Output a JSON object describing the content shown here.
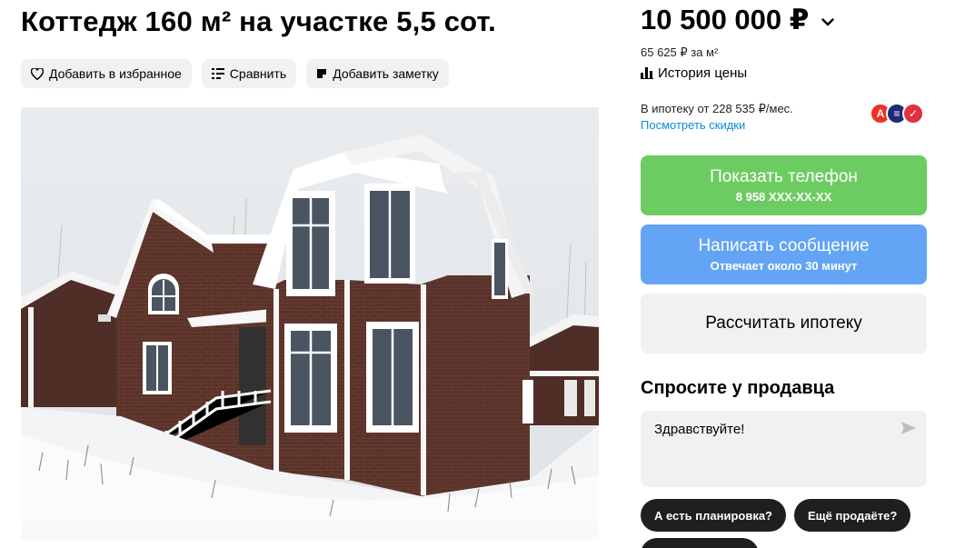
{
  "listing": {
    "title": "Коттедж 160 м² на участке 5,5 сот."
  },
  "actions": {
    "favorite_label": "Добавить в избранное",
    "compare_label": "Сравнить",
    "note_label": "Добавить заметку"
  },
  "price": {
    "value": "10 500 000 ₽",
    "per_m2": "65 625 ₽ за м²",
    "history_label": "История цены"
  },
  "mortgage": {
    "text": "В ипотеку от 228 535 ₽/мес.",
    "discounts_link": "Посмотреть скидки",
    "banks": [
      {
        "icon": "alfa-bank-icon",
        "glyph": "А",
        "color": "#ef3124"
      },
      {
        "icon": "bank-stripes-icon",
        "glyph": "≡",
        "color": "#1e2a78"
      },
      {
        "icon": "bank-check-icon",
        "glyph": "✓",
        "color": "#e0323c"
      }
    ]
  },
  "contact": {
    "phone_label": "Показать телефон",
    "phone_masked": "8 958 XXX-XX-XX",
    "message_label": "Написать сообщение",
    "message_sub": "Отвечает около 30 минут",
    "calc_label": "Рассчитать ипотеку"
  },
  "ask": {
    "title": "Спросите у продавца",
    "input_value": "Здравствуйте!",
    "chips": [
      "А есть планировка?",
      "Ещё продаёте?"
    ]
  },
  "colors": {
    "green": "#6ccc62",
    "blue": "#63a4f4",
    "link": "#0a8bdc"
  }
}
